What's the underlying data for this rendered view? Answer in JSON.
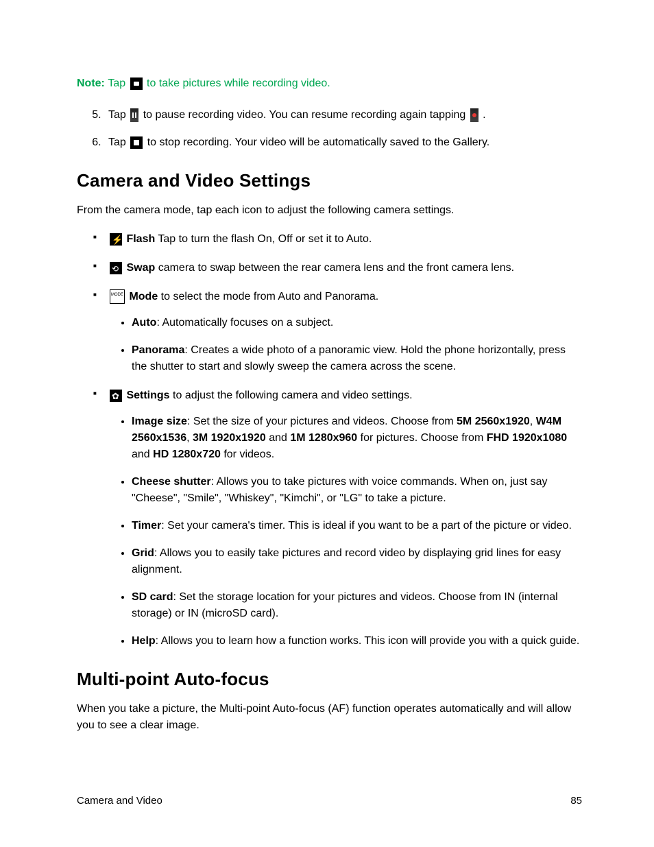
{
  "note": {
    "label": "Note:",
    "before_icon": "Tap",
    "after_icon": "to take pictures while recording video."
  },
  "steps": {
    "s5": {
      "prefix": "Tap",
      "mid": "to pause recording video. You can resume recording again tapping",
      "suffix": "."
    },
    "s6": {
      "prefix": "Tap",
      "suffix": "to stop recording. Your video will be automatically saved to the Gallery."
    }
  },
  "heading_1": "Camera and Video Settings",
  "intro_1": "From the camera mode, tap each icon to adjust the following camera settings.",
  "flash": {
    "label": "Flash",
    "text": " Tap to turn the flash On, Off or set it to Auto."
  },
  "swap": {
    "label": "Swap",
    "text": " camera to swap between the rear camera lens and the front camera lens."
  },
  "mode": {
    "label": "Mode",
    "text": " to select the mode from Auto and Panorama.",
    "icon_text": "MODE",
    "auto": {
      "label": "Auto",
      "text": ": Automatically focuses on a subject."
    },
    "panorama": {
      "label": "Panorama",
      "text": ": Creates a wide photo of a panoramic view. Hold the phone horizontally, press the shutter to start and slowly sweep the camera across the scene."
    }
  },
  "settings": {
    "label": "Settings",
    "text": " to adjust the following camera and video settings.",
    "image_size": {
      "label": "Image size",
      "t1": ": Set the size of your pictures and videos. Choose from ",
      "b1": "5M 2560x1920",
      "t2": ", ",
      "b2": "W4M 2560x1536",
      "t3": ", ",
      "b3": "3M 1920x1920",
      "t4": " and ",
      "b4": "1M 1280x960",
      "t5": " for pictures. Choose from ",
      "b5": "FHD 1920x1080",
      "t6": " and ",
      "b6": "HD 1280x720",
      "t7": " for videos."
    },
    "cheese": {
      "label": "Cheese shutter",
      "text": ": Allows you to take pictures with voice commands. When on, just say \"Cheese\", \"Smile\", \"Whiskey\", \"Kimchi\", or \"LG\" to take a picture."
    },
    "timer": {
      "label": "Timer",
      "text": ": Set your camera's timer. This is ideal if you want to be a part of the picture or video."
    },
    "grid": {
      "label": "Grid",
      "text": ": Allows you to easily take pictures and record video by displaying grid lines for easy alignment."
    },
    "sd": {
      "label": "SD card",
      "text": ": Set the storage location for your pictures and videos. Choose from IN (internal storage) or IN (microSD card)."
    },
    "help": {
      "label": "Help",
      "text": ": Allows you to learn how a function works. This icon will provide you with a quick guide."
    }
  },
  "heading_2": "Multi-point Auto-focus",
  "intro_2": "When you take a picture, the Multi-point Auto-focus (AF) function operates automatically and will allow you to see a clear image.",
  "footer": {
    "section": "Camera and Video",
    "page": "85"
  }
}
